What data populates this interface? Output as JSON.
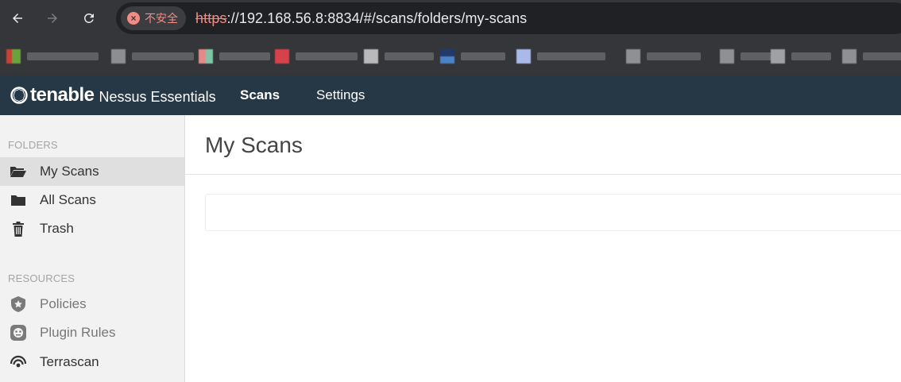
{
  "browser": {
    "security_label": "不安全",
    "url_scheme": "https",
    "url_rest": "://192.168.56.8:8834/#/scans/folders/my-scans",
    "icons": [
      "back-arrow-icon",
      "forward-arrow-icon",
      "reload-icon",
      "warning-icon"
    ],
    "bookmarks_blurred": true
  },
  "header": {
    "brand": "tenable",
    "product": "Nessus Essentials",
    "nav": [
      {
        "label": "Scans",
        "active": true
      },
      {
        "label": "Settings",
        "active": false
      }
    ],
    "background_color": "#263746"
  },
  "sidebar": {
    "folders_heading": "FOLDERS",
    "folders": [
      {
        "label": "My Scans",
        "icon": "folder-open-icon",
        "active": true
      },
      {
        "label": "All Scans",
        "icon": "folder-icon",
        "active": false
      },
      {
        "label": "Trash",
        "icon": "trash-icon",
        "active": false
      }
    ],
    "resources_heading": "RESOURCES",
    "resources": [
      {
        "label": "Policies",
        "icon": "shield-star-icon"
      },
      {
        "label": "Plugin Rules",
        "icon": "plugin-rules-icon"
      },
      {
        "label": "Terrascan",
        "icon": "terrascan-icon"
      }
    ]
  },
  "main": {
    "title": "My Scans"
  }
}
